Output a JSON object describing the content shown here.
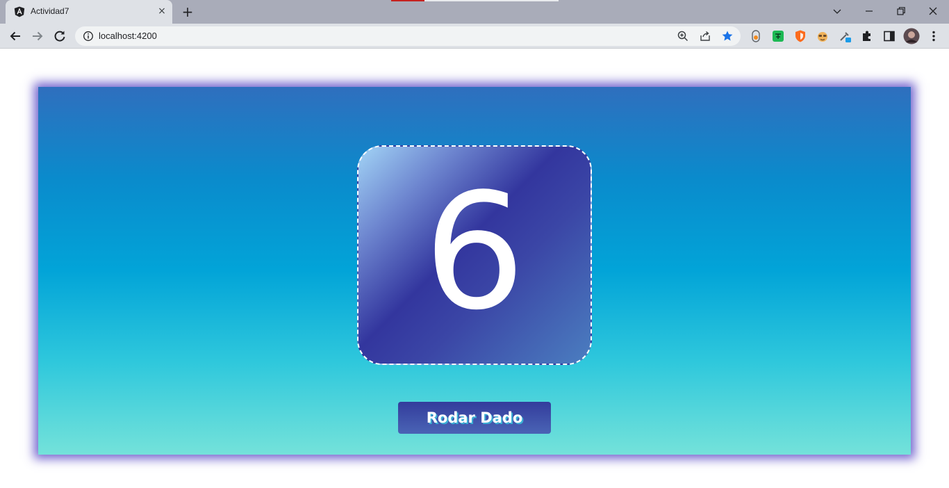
{
  "browser": {
    "tab": {
      "title": "Actividad7",
      "close_label": "×",
      "favicon": "angular-icon"
    },
    "new_tab_label": "+",
    "window_controls": {
      "tab_search": "chevron-down-icon",
      "minimize": "minimize-icon",
      "restore": "restore-icon",
      "close": "close-icon"
    },
    "toolbar": {
      "back": "back-arrow-icon",
      "forward": "forward-arrow-icon",
      "reload": "reload-icon",
      "url": "localhost:4200",
      "omnibox_icons": [
        "zoom-icon",
        "share-icon",
        "bookmark-star-icon"
      ],
      "extensions": [
        "extension-orange-icon",
        "extension-green-icon",
        "extension-shield-icon",
        "extension-face-icon",
        "extension-dropper-icon",
        "extensions-puzzle-icon",
        "side-panel-icon",
        "profile-avatar",
        "menu-kebab-icon"
      ]
    }
  },
  "app": {
    "die_value": "6",
    "roll_button_label": "Rodar Dado"
  },
  "colors": {
    "stage_top": "#2f6fbe",
    "stage_bottom": "#74e2da",
    "stage_glow": "#4632be",
    "die_dark": "#33369e",
    "die_light": "#a2d4f6",
    "button": "#3b4aa6",
    "button_text_shadow": "#3aaed4"
  }
}
